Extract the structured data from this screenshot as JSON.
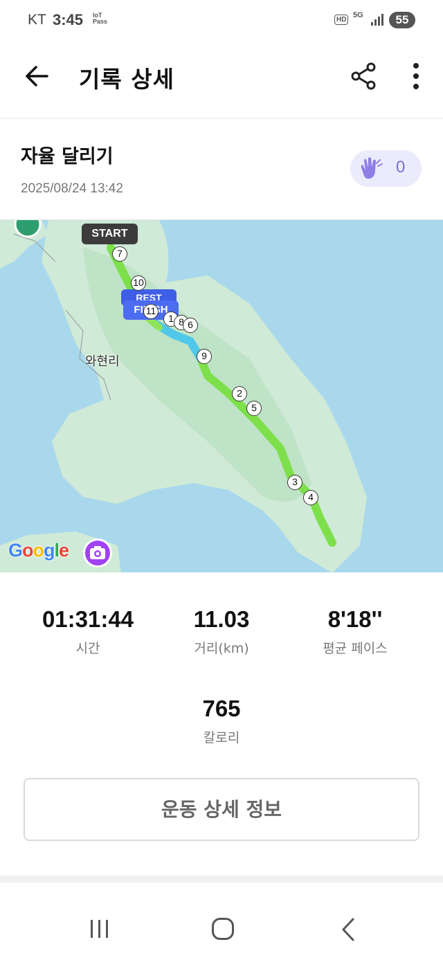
{
  "status_bar": {
    "carrier": "KT",
    "time": "3:45",
    "iot_line1": "IoT",
    "iot_line2": "Pass",
    "hd": "HD",
    "network": "5G",
    "battery": "55"
  },
  "header": {
    "title": "기록 상세",
    "back_icon": "arrow-left-icon",
    "share_icon": "share-icon",
    "more_icon": "more-vertical-icon"
  },
  "record": {
    "title": "자율 달리기",
    "date": "2025/08/24 13:42",
    "clap_count": "0",
    "clap_icon": "clapping-hands-icon"
  },
  "map": {
    "start_label": "START",
    "finish_label": "FINISH",
    "rest_label": "REST",
    "place_label": "와현리",
    "google_logo": "Google",
    "camera_icon": "add-photo-icon",
    "km_markers": [
      "7",
      "10",
      "11",
      "1",
      "8",
      "6",
      "9",
      "2",
      "5",
      "3",
      "4"
    ],
    "colors": {
      "water": "#a9d8ec",
      "land": "#cfead6",
      "route_fast": "#7de04a",
      "route_slow": "#4fc8ea"
    }
  },
  "stats": {
    "time_value": "01:31:44",
    "time_label": "시간",
    "distance_value": "11.03",
    "distance_label": "거리(km)",
    "pace_value": "8'18''",
    "pace_label": "평균 페이스",
    "calories_value": "765",
    "calories_label": "칼로리"
  },
  "actions": {
    "detail_button": "운동 상세 정보"
  },
  "nav_bar": {
    "recent_icon": "recent-apps-icon",
    "home_icon": "home-icon",
    "back_icon": "nav-back-icon"
  }
}
